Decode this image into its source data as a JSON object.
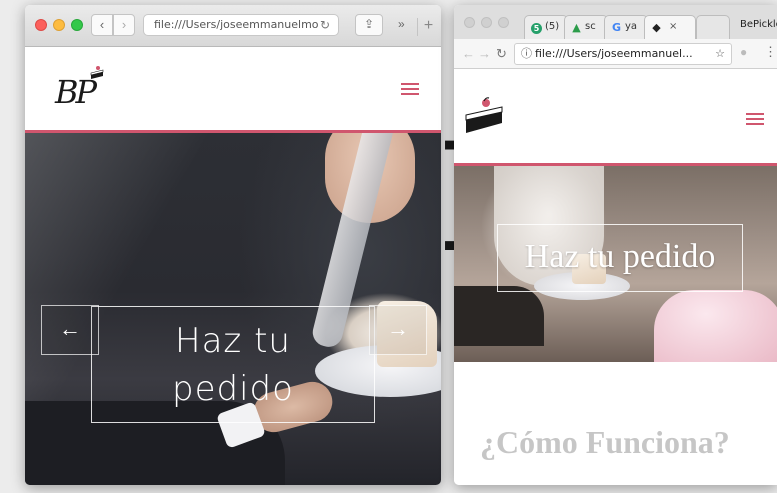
{
  "safari": {
    "address": "file:///Users/joseemmanuelmo",
    "more": "»",
    "new_tab": "+",
    "logo_text": "BP",
    "hero": {
      "prev_arrow": "←",
      "next_arrow": "→",
      "cta_line1": "Haz tu",
      "cta_line2": "pedido"
    }
  },
  "chrome": {
    "tabs": [
      {
        "label": "(5)",
        "icon": "5"
      },
      {
        "label": "sc",
        "icon": "drive-icon"
      },
      {
        "label": "ya",
        "icon": "G"
      },
      {
        "label": "",
        "close": "×"
      },
      {
        "label": ""
      }
    ],
    "user_label": "BePickler",
    "address": "file:///Users/joseemmanuel...",
    "hero_cta": "Haz tu pedido",
    "section_title": "¿Cómo Funciona?"
  },
  "colors": {
    "accent": "#d0566e",
    "heading_gray": "#c6c6c6"
  }
}
